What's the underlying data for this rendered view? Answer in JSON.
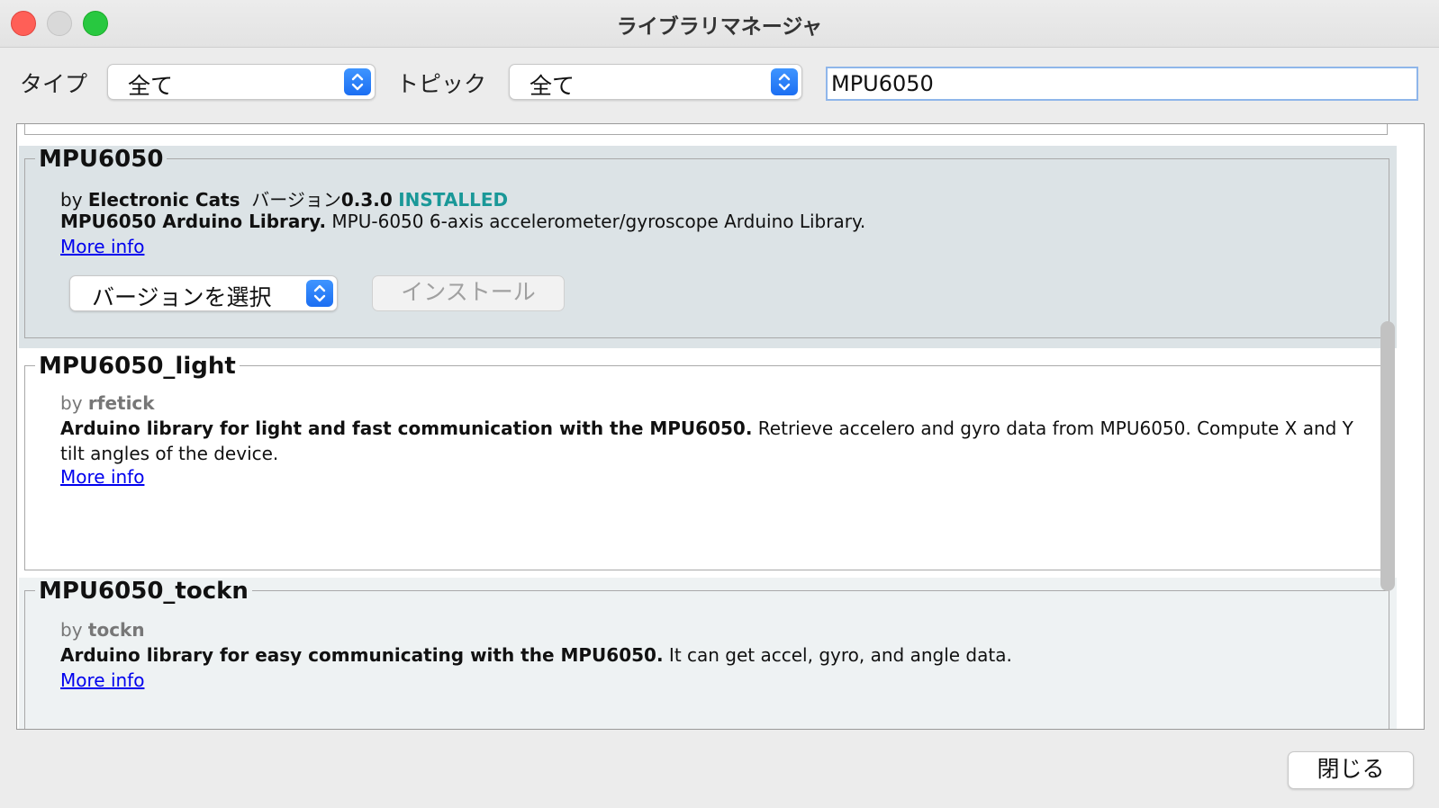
{
  "window": {
    "title": "ライブラリマネージャ"
  },
  "filters": {
    "type_label": "タイプ",
    "type_value": "全て",
    "topic_label": "トピック",
    "topic_value": "全て",
    "search_value": "MPU6050"
  },
  "libraries": [
    {
      "name": "MPU6050",
      "by_prefix": "by",
      "author": "Electronic Cats",
      "version_label": "バージョン",
      "version": "0.3.0",
      "status": "INSTALLED",
      "summary": "MPU6050 Arduino Library.",
      "description": "MPU-6050 6-axis accelerometer/gyroscope Arduino Library.",
      "more_info": "More info",
      "version_select": "バージョンを選択",
      "install": "インストール"
    },
    {
      "name": "MPU6050_light",
      "by_prefix": "by",
      "author": "rfetick",
      "summary": "Arduino library for light and fast communication with the MPU6050.",
      "description": "Retrieve accelero and gyro data from MPU6050. Compute X and Y",
      "description_line2": "tilt angles of the device.",
      "more_info": "More info"
    },
    {
      "name": "MPU6050_tockn",
      "by_prefix": "by",
      "author": "tockn",
      "summary": "Arduino library for easy communicating with the MPU6050.",
      "description": "It can get accel, gyro, and angle data.",
      "more_info": "More info"
    }
  ],
  "footer": {
    "close_label": "閉じる"
  },
  "colors": {
    "installed": "#1a9898",
    "link": "#0000ee",
    "selected_row": "#dce3e6",
    "alt_row": "#eef2f3",
    "accent": "#1b6ef2"
  }
}
